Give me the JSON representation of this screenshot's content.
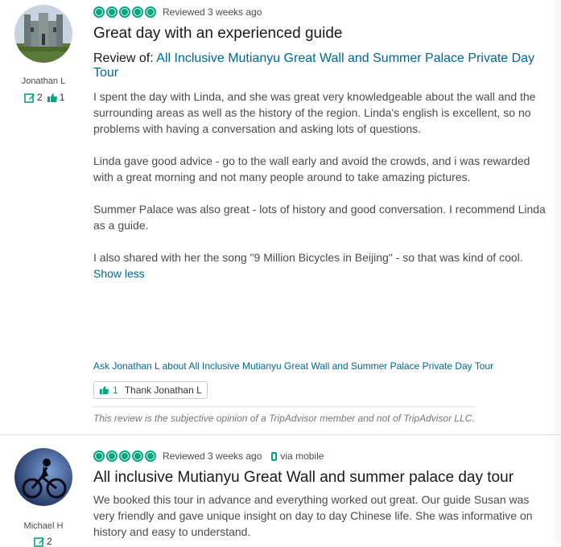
{
  "review1": {
    "username": "Jonathan L",
    "review_count": "2",
    "helpful_count": "1",
    "reviewed_date": "Reviewed 3 weeks ago",
    "title": "Great day with an experienced guide",
    "review_of_label": "Review of:",
    "review_of_link": "All Inclusive Mutianyu Great Wall and Summer Palace Private Day Tour",
    "paragraphs": [
      "I spent the day with Linda, and she was great very knowledgeable about the wall and the surrounding areas as well as the history of the region. Linda's english is excellent, so no problems with having a conversation and asking lots of questions.",
      "Linda gave good advice - go to the wall early and avoid the crowds, and i was rewarded with a great morning and not many people around to take amazing pictures.",
      "Summer Palace was also great - lots of history and good conversation. I recommend Linda as a guide.",
      "I also shared with her the song \"9 Million Bicycles in Beijing\" - so that was kind of cool."
    ],
    "show_less": "Show less",
    "ask_link": "Ask Jonathan L about All Inclusive Mutianyu Great Wall and Summer Palace Private Day Tour",
    "thank_count": "1",
    "thank_label": "Thank Jonathan L",
    "disclaimer": "This review is the subjective opinion of a TripAdvisor member and not of TripAdvisor LLC."
  },
  "review2": {
    "username": "Michael H",
    "review_count": "2",
    "reviewed_date": "Reviewed 3 weeks ago",
    "via": "via mobile",
    "title": "All inclusive Mutianyu Great Wall and summer palace day tour",
    "text": "We booked this tour in advance and everything worked out great. Our guide Susan was very friendly and gave unique insight on day to day Chinese life. She was informative on history and easy to understand."
  },
  "colors": {
    "accent": "#00a680",
    "link": "#006699"
  }
}
